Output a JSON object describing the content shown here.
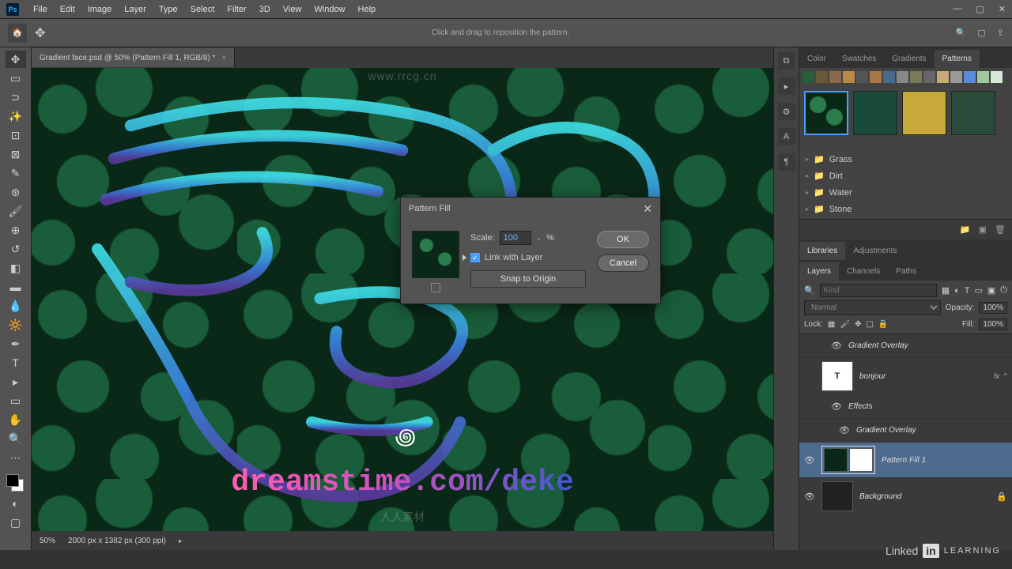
{
  "menubar": [
    "File",
    "Edit",
    "Image",
    "Layer",
    "Type",
    "Select",
    "Filter",
    "3D",
    "View",
    "Window",
    "Help"
  ],
  "optbar": {
    "hint": "Click and drag to reposition the pattern."
  },
  "doctab": {
    "title": "Gradient face.psd @ 50% (Pattern Fill 1, RGB/8) *"
  },
  "watermark_top": "www.rrcg.cn",
  "watermark_bottom": "人人素材",
  "canvas": {
    "url_text": "dreamstime.com/deke"
  },
  "statusbar": {
    "zoom": "50%",
    "docinfo": "2000 px x 1382 px (300 ppi)"
  },
  "dialog": {
    "title": "Pattern Fill",
    "scale_label": "Scale:",
    "scale_value": "100",
    "scale_unit": "%",
    "link_label": "Link with Layer",
    "snap_label": "Snap to Origin",
    "ok": "OK",
    "cancel": "Cancel"
  },
  "right": {
    "tabs_top": [
      "Color",
      "Swatches",
      "Gradients",
      "Patterns"
    ],
    "folders": [
      "Grass",
      "Dirt",
      "Water",
      "Stone"
    ],
    "tabs_mid": [
      "Libraries",
      "Adjustments"
    ],
    "tabs_layers": [
      "Layers",
      "Channels",
      "Paths"
    ],
    "filter_placeholder": "Kind",
    "blend_mode": "Normal",
    "opacity_label": "Opacity:",
    "opacity_val": "100%",
    "lock_label": "Lock:",
    "fill_label": "Fill:",
    "fill_val": "100%",
    "layers": [
      {
        "name": "Gradient Overlay",
        "type": "effect-line"
      },
      {
        "name": "bonjour",
        "type": "text",
        "fx": true
      },
      {
        "name": "Effects",
        "type": "effects-header"
      },
      {
        "name": "Gradient Overlay",
        "type": "effect-line"
      },
      {
        "name": "Pattern Fill 1",
        "type": "pattern",
        "selected": true
      },
      {
        "name": "Background",
        "type": "bg",
        "locked": true
      }
    ]
  },
  "linkedin": {
    "brand": "Linked",
    "in": "in",
    "sub": "LEARNING"
  }
}
